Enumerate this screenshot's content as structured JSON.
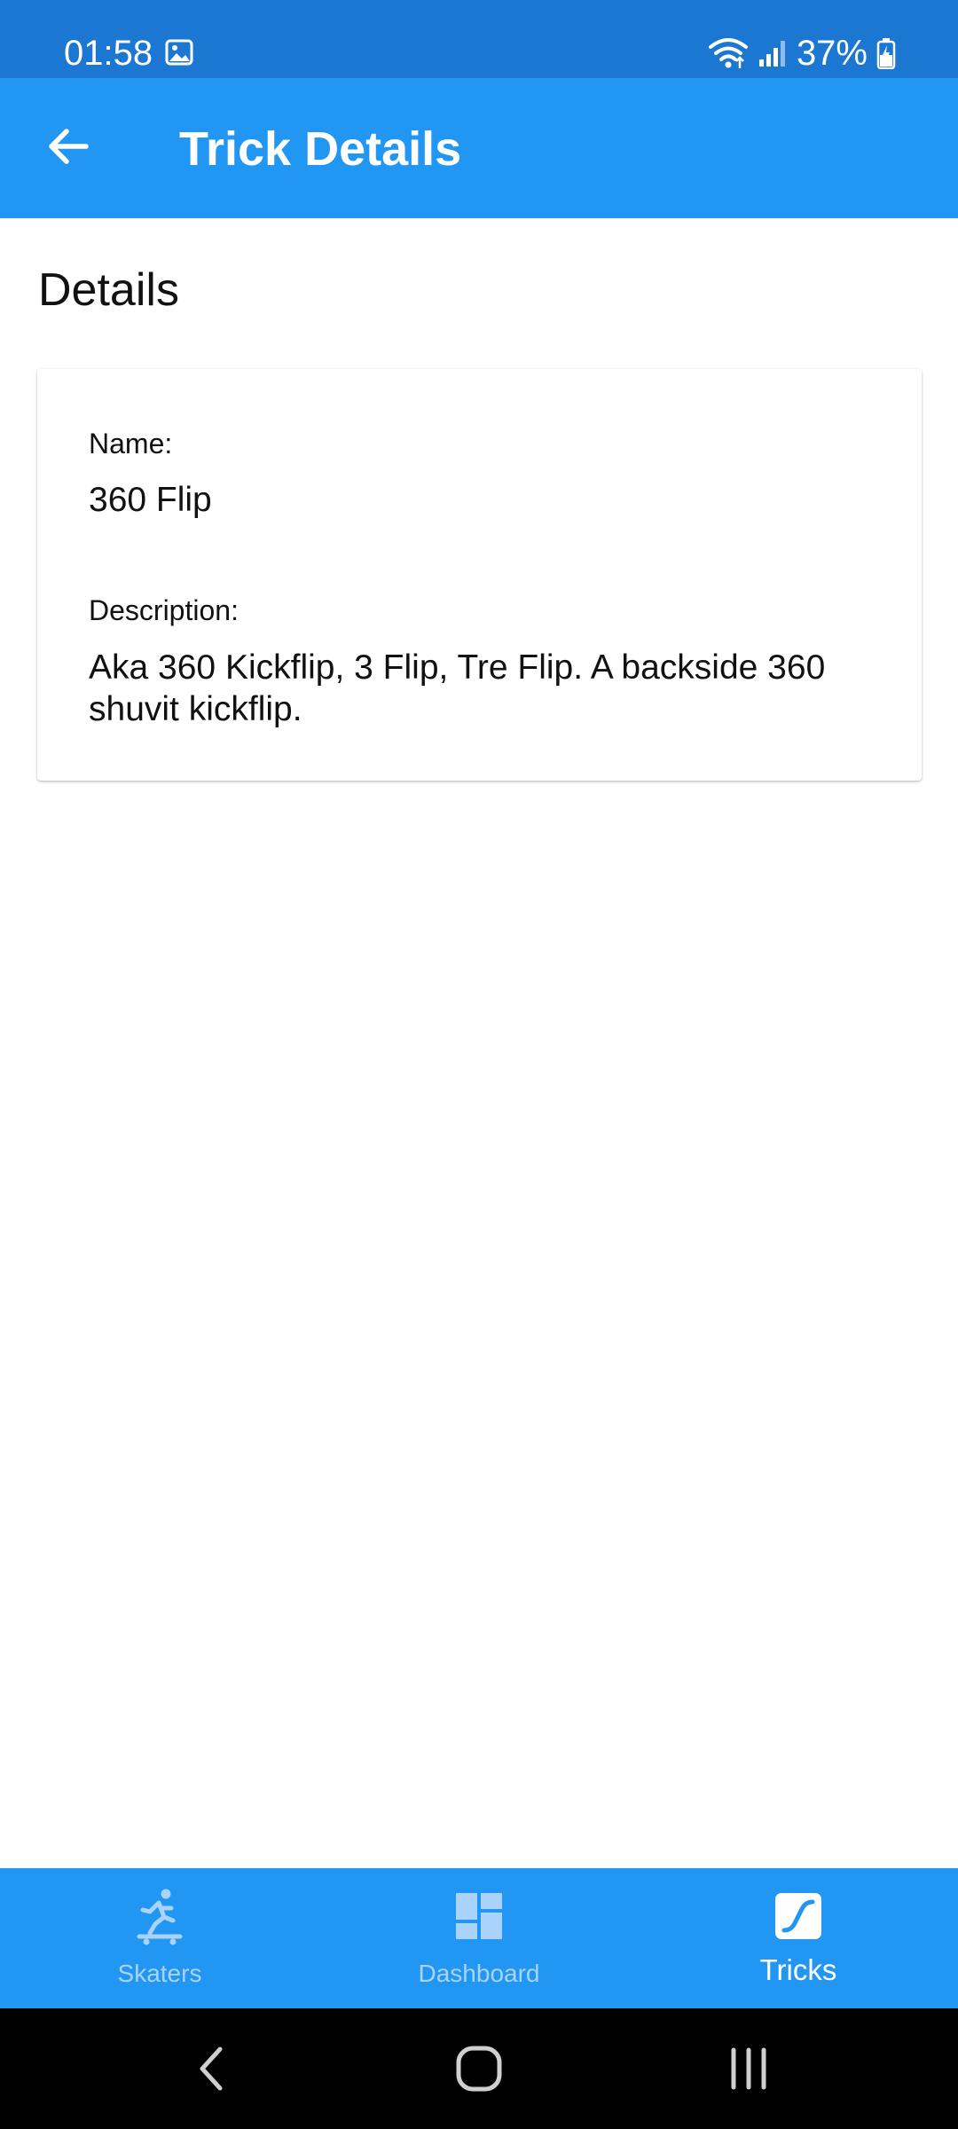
{
  "status_bar": {
    "time": "01:58",
    "battery": "37%",
    "icons": [
      "gallery-icon",
      "wifi-icon",
      "signal-icon",
      "battery-charging-icon"
    ]
  },
  "app_bar": {
    "title": "Trick Details",
    "back_icon": "arrow-back-icon"
  },
  "section": {
    "title": "Details"
  },
  "card": {
    "name_label": "Name:",
    "name_value": "360 Flip",
    "description_label": "Description:",
    "description_value": "Aka 360 Kickflip, 3 Flip, Tre Flip. A backside 360 shuvit kickflip."
  },
  "bottom_nav": {
    "items": [
      {
        "label": "Skaters",
        "icon": "skater-icon",
        "active": false
      },
      {
        "label": "Dashboard",
        "icon": "dashboard-icon",
        "active": false
      },
      {
        "label": "Tricks",
        "icon": "tricks-icon",
        "active": true
      }
    ]
  },
  "colors": {
    "status_bar": "#1b77d1",
    "primary": "#2196f3",
    "nav_inactive": "#a9d3fa",
    "nav_active": "#ffffff"
  }
}
